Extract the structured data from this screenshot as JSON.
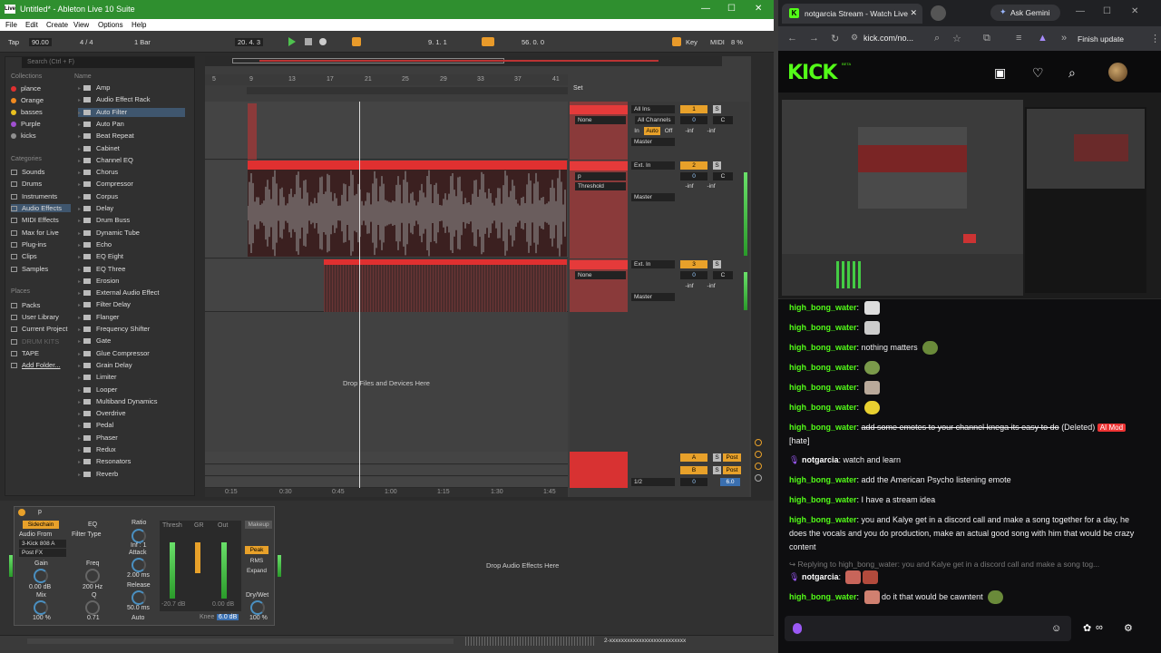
{
  "ableton": {
    "title": "Untitled* - Ableton Live 10 Suite",
    "app_icon": "Live",
    "window_controls": [
      "—",
      "☐",
      "✕"
    ],
    "menu": [
      "File",
      "Edit",
      "Create",
      "View",
      "Options",
      "Help"
    ],
    "transport": {
      "tap": "Tap",
      "tempo": "90.00",
      "sig": "4 / 4",
      "quant": "1 Bar",
      "position": "20. 4. 3",
      "loop_start": "9. 1. 1",
      "loop_len": "56. 0. 0",
      "key": "Key",
      "midi": "MIDI",
      "cpu": "8 %"
    },
    "browser": {
      "search_placeholder": "Search (Ctrl + F)",
      "collections_header": "Collections",
      "collections": [
        {
          "label": "plance",
          "color": "#e03030"
        },
        {
          "label": "Orange",
          "color": "#f08a20"
        },
        {
          "label": "basses",
          "color": "#e8c020"
        },
        {
          "label": "Purple",
          "color": "#a050d0"
        },
        {
          "label": "kicks",
          "color": "#909090"
        }
      ],
      "categories_header": "Categories",
      "categories": [
        "Sounds",
        "Drums",
        "Instruments",
        "Audio Effects",
        "MIDI Effects",
        "Max for Live",
        "Plug-ins",
        "Clips",
        "Samples"
      ],
      "places_header": "Places",
      "places": [
        "Packs",
        "User Library",
        "Current Project",
        "DRUM KITS",
        "TAPE",
        "Add Folder..."
      ],
      "name_header": "Name",
      "items": [
        "Amp",
        "Audio Effect Rack",
        "Auto Filter",
        "Auto Pan",
        "Beat Repeat",
        "Cabinet",
        "Channel EQ",
        "Chorus",
        "Compressor",
        "Corpus",
        "Delay",
        "Drum Buss",
        "Dynamic Tube",
        "Echo",
        "EQ Eight",
        "EQ Three",
        "Erosion",
        "External Audio Effect",
        "Filter Delay",
        "Flanger",
        "Frequency Shifter",
        "Gate",
        "Glue Compressor",
        "Grain Delay",
        "Limiter",
        "Looper",
        "Multiband Dynamics",
        "Overdrive",
        "Pedal",
        "Phaser",
        "Redux",
        "Resonators",
        "Reverb"
      ]
    },
    "ruler": [
      "5",
      "9",
      "13",
      "17",
      "21",
      "25",
      "29",
      "33",
      "37",
      "41"
    ],
    "timebar": [
      "0:15",
      "0:30",
      "0:45",
      "1:00",
      "1:15",
      "1:30",
      "1:45"
    ],
    "set_label": "Set",
    "mixer": {
      "tracks": [
        {
          "input": "All Ins",
          "sub": "All Channels",
          "in_label": "In",
          "auto": "Auto",
          "off": "Off",
          "route": "Master",
          "num": "1",
          "vol": "0",
          "pan": "C",
          "send1": "-inf",
          "send2": "-inf",
          "chooser": "None"
        },
        {
          "input": "Ext. In",
          "sub": "",
          "route": "Master",
          "num": "2",
          "vol": "0",
          "pan": "C",
          "send1": "-inf",
          "send2": "-inf",
          "chooser": "p",
          "chooser2": "Threshold"
        },
        {
          "input": "Ext. In",
          "sub": "",
          "route": "Master",
          "num": "3",
          "vol": "0",
          "pan": "C",
          "send1": "-inf",
          "send2": "-inf",
          "chooser": "None"
        }
      ],
      "returns": [
        {
          "letter": "A",
          "post": "Post"
        },
        {
          "letter": "B",
          "post": "Post"
        }
      ],
      "master_cue": "1/2",
      "master_vol": "0",
      "master_db": "6.0"
    },
    "drop_arrangement": "Drop Files and Devices Here",
    "device": {
      "name": "p",
      "sidechain": "Sidechain",
      "eq": "EQ",
      "audio_from": "Audio From",
      "source": "3-Kick 808 A",
      "postfx": "Post FX",
      "gain": "Gain",
      "gain_val": "0.00 dB",
      "mix": "Mix",
      "mix_val": "100 %",
      "filter_type": "Filter Type",
      "freq": "Freq",
      "freq_val": "200 Hz",
      "q": "Q",
      "q_val": "0.71",
      "ratio": "Ratio",
      "ratio_val": "Inf : 1",
      "attack": "Attack",
      "attack_val": "2.00 ms",
      "release": "Release",
      "release_val": "50.0 ms",
      "auto": "Auto",
      "thresh": "Thresh",
      "gr": "GR",
      "out": "Out",
      "thresh_val": "-20.7 dB",
      "out_val": "0.00 dB",
      "knee": "Knee",
      "knee_val": "6.0 dB",
      "makeup": "Makeup",
      "peak": "Peak",
      "rms": "RMS",
      "expand": "Expand",
      "drywet": "Dry/Wet",
      "drywet_val": "100 %"
    },
    "drop_device": "Drop Audio Effects Here",
    "status_right": "2-xxxxxxxxxxxxxxxxxxxxxxxxxx"
  },
  "browser": {
    "tab_title": "notgarcia Stream - Watch Live",
    "ask_gemini": "Ask Gemini",
    "url": "kick.com/no...",
    "finish_update": "Finish update",
    "logo": "KICK",
    "logo_badge": "BETA"
  },
  "chat": [
    {
      "user": "high_bong_water",
      "text": "",
      "emote": "#ddd"
    },
    {
      "user": "high_bong_water",
      "text": "",
      "emote": "#ccc"
    },
    {
      "user": "high_bong_water",
      "text": "nothing matters",
      "emote": "#6a8a3a"
    },
    {
      "user": "high_bong_water",
      "text": "",
      "emote": "#7a9a4a"
    },
    {
      "user": "high_bong_water",
      "text": "",
      "emote": "#b9a99a"
    },
    {
      "user": "high_bong_water",
      "text": "",
      "emote": "#e8d030"
    },
    {
      "user": "high_bong_water",
      "text": "add some emotes to your channel knega its easy to do",
      "deleted": "(Deleted)",
      "ai_mod": "AI Mod",
      "tag": "[hate]"
    },
    {
      "user": "notgarcia",
      "text": "watch and learn"
    },
    {
      "user": "high_bong_water",
      "text": "add the American Psycho listening emote"
    },
    {
      "user": "high_bong_water",
      "text": "I have a stream idea"
    },
    {
      "user": "high_bong_water",
      "text": "you and Kalye get in a discord call and make a song together for a day, he does the vocals and you do production, make an actual good song with him that would be crazy content"
    },
    {
      "reply": "Replying to high_bong_water: you and Kalye get in a discord call and make a song tog..."
    },
    {
      "user": "notgarcia",
      "text": ""
    },
    {
      "user": "high_bong_water",
      "text": "do it that would be cawntent"
    }
  ]
}
